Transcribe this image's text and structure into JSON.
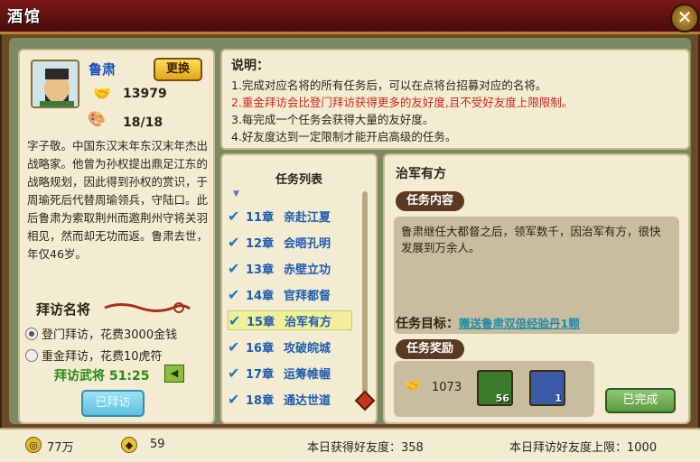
{
  "window": {
    "title": "酒馆",
    "close_icon": "close-icon"
  },
  "general": {
    "name": "鲁肃",
    "swap_label": "更换",
    "friendship": "13979",
    "visits": "18/18",
    "bio": "字子敬。中国东汉末年东汉末年杰出战略家。他曾为孙权提出鼎足江东的战略规划，因此得到孙权的赏识，于周瑜死后代替周瑜领兵，守陆口。此后鲁肃为索取荆州而邀荆州守将关羽相见，然而却无功而返。鲁肃去世，年仅46岁。"
  },
  "visit": {
    "title": "拜访名将",
    "options": [
      {
        "label": "登门拜访，花费3000金钱",
        "selected": true
      },
      {
        "label": "重金拜访，花费10虎符",
        "selected": false
      }
    ],
    "timer_label": "拜访武将 51:25",
    "button_label": "已拜访"
  },
  "description": {
    "title": "说明：",
    "lines": [
      "1.完成对应名将的所有任务后，可以在点将台招募对应的名将。",
      "2.重金拜访会比登门拜访获得更多的友好度,且不受好友度上限限制。",
      "3.每完成一个任务会获得大量的友好度。",
      "4.好友度达到一定限制才能开启高级的任务。"
    ]
  },
  "quest_list": {
    "title": "任务列表",
    "items": [
      {
        "chapter": "11章",
        "name": "亲赴江夏",
        "selected": false
      },
      {
        "chapter": "12章",
        "name": "会晤孔明",
        "selected": false
      },
      {
        "chapter": "13章",
        "name": "赤壁立功",
        "selected": false
      },
      {
        "chapter": "14章",
        "name": "官拜都督",
        "selected": false
      },
      {
        "chapter": "15章",
        "name": "治军有方",
        "selected": true
      },
      {
        "chapter": "16章",
        "name": "攻破皖城",
        "selected": false
      },
      {
        "chapter": "17章",
        "name": "运筹帷幄",
        "selected": false
      },
      {
        "chapter": "18章",
        "name": "通达世道",
        "selected": false
      }
    ]
  },
  "quest_detail": {
    "title": "治军有方",
    "content_banner": "任务内容",
    "content": "鲁肃继任大都督之后，领军数千，因治军有方，很快发展到万余人。",
    "goal_label": "任务目标：",
    "goal_link": "赠送鲁肃双倍经验丹1颗",
    "reward_banner": "任务奖励",
    "reward_friendship": "1073",
    "reward_items": [
      {
        "count": "56"
      },
      {
        "count": "1"
      }
    ],
    "done_label": "已完成"
  },
  "footer": {
    "gold": "77万",
    "ingot": "59",
    "today_friendship_label": "本日获得好友度：358",
    "today_limit_label": "本日拜访好友度上限：1000"
  },
  "colors": {
    "title_bar": "#7a1818",
    "panel_bg": "#f3ecd2",
    "frame_bg": "#7b8a62",
    "link_blue": "#1f5bb0",
    "red_text": "#d0241c"
  }
}
